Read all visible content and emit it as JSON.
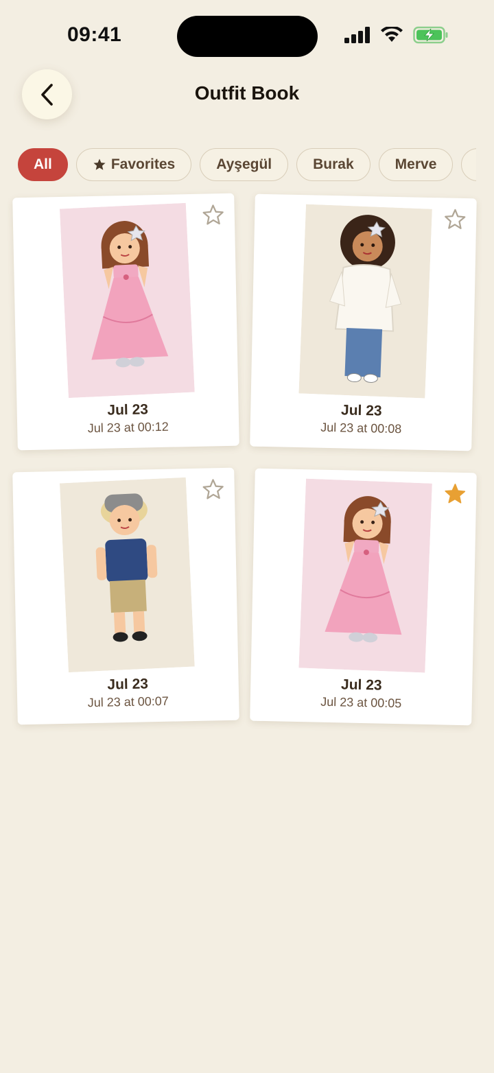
{
  "status": {
    "time": "09:41"
  },
  "header": {
    "title": "Outfit Book"
  },
  "filters": [
    {
      "label": "All",
      "active": true,
      "icon": ""
    },
    {
      "label": "Favorites",
      "active": false,
      "icon": "star-icon"
    },
    {
      "label": "Ayşegül",
      "active": false,
      "icon": ""
    },
    {
      "label": "Burak",
      "active": false,
      "icon": ""
    },
    {
      "label": "Merve",
      "active": false,
      "icon": ""
    },
    {
      "label": "",
      "active": false,
      "icon": ""
    }
  ],
  "outfits": [
    {
      "title": "Jul 23",
      "subtitle": "Jul 23 at 00:12",
      "favorite": false,
      "background": "#f4dce3",
      "character": "princess"
    },
    {
      "title": "Jul 23",
      "subtitle": "Jul 23 at 00:08",
      "favorite": false,
      "background": "#efe8da",
      "character": "fur-coat"
    },
    {
      "title": "Jul 23",
      "subtitle": "Jul 23 at 00:07",
      "favorite": false,
      "background": "#efe8da",
      "character": "boy"
    },
    {
      "title": "Jul 23",
      "subtitle": "Jul 23 at 00:05",
      "favorite": true,
      "background": "#f4dce3",
      "character": "princess"
    }
  ],
  "colors": {
    "accent": "#c5443c",
    "favorite_star": "#e8a033",
    "background": "#f3eee2"
  }
}
